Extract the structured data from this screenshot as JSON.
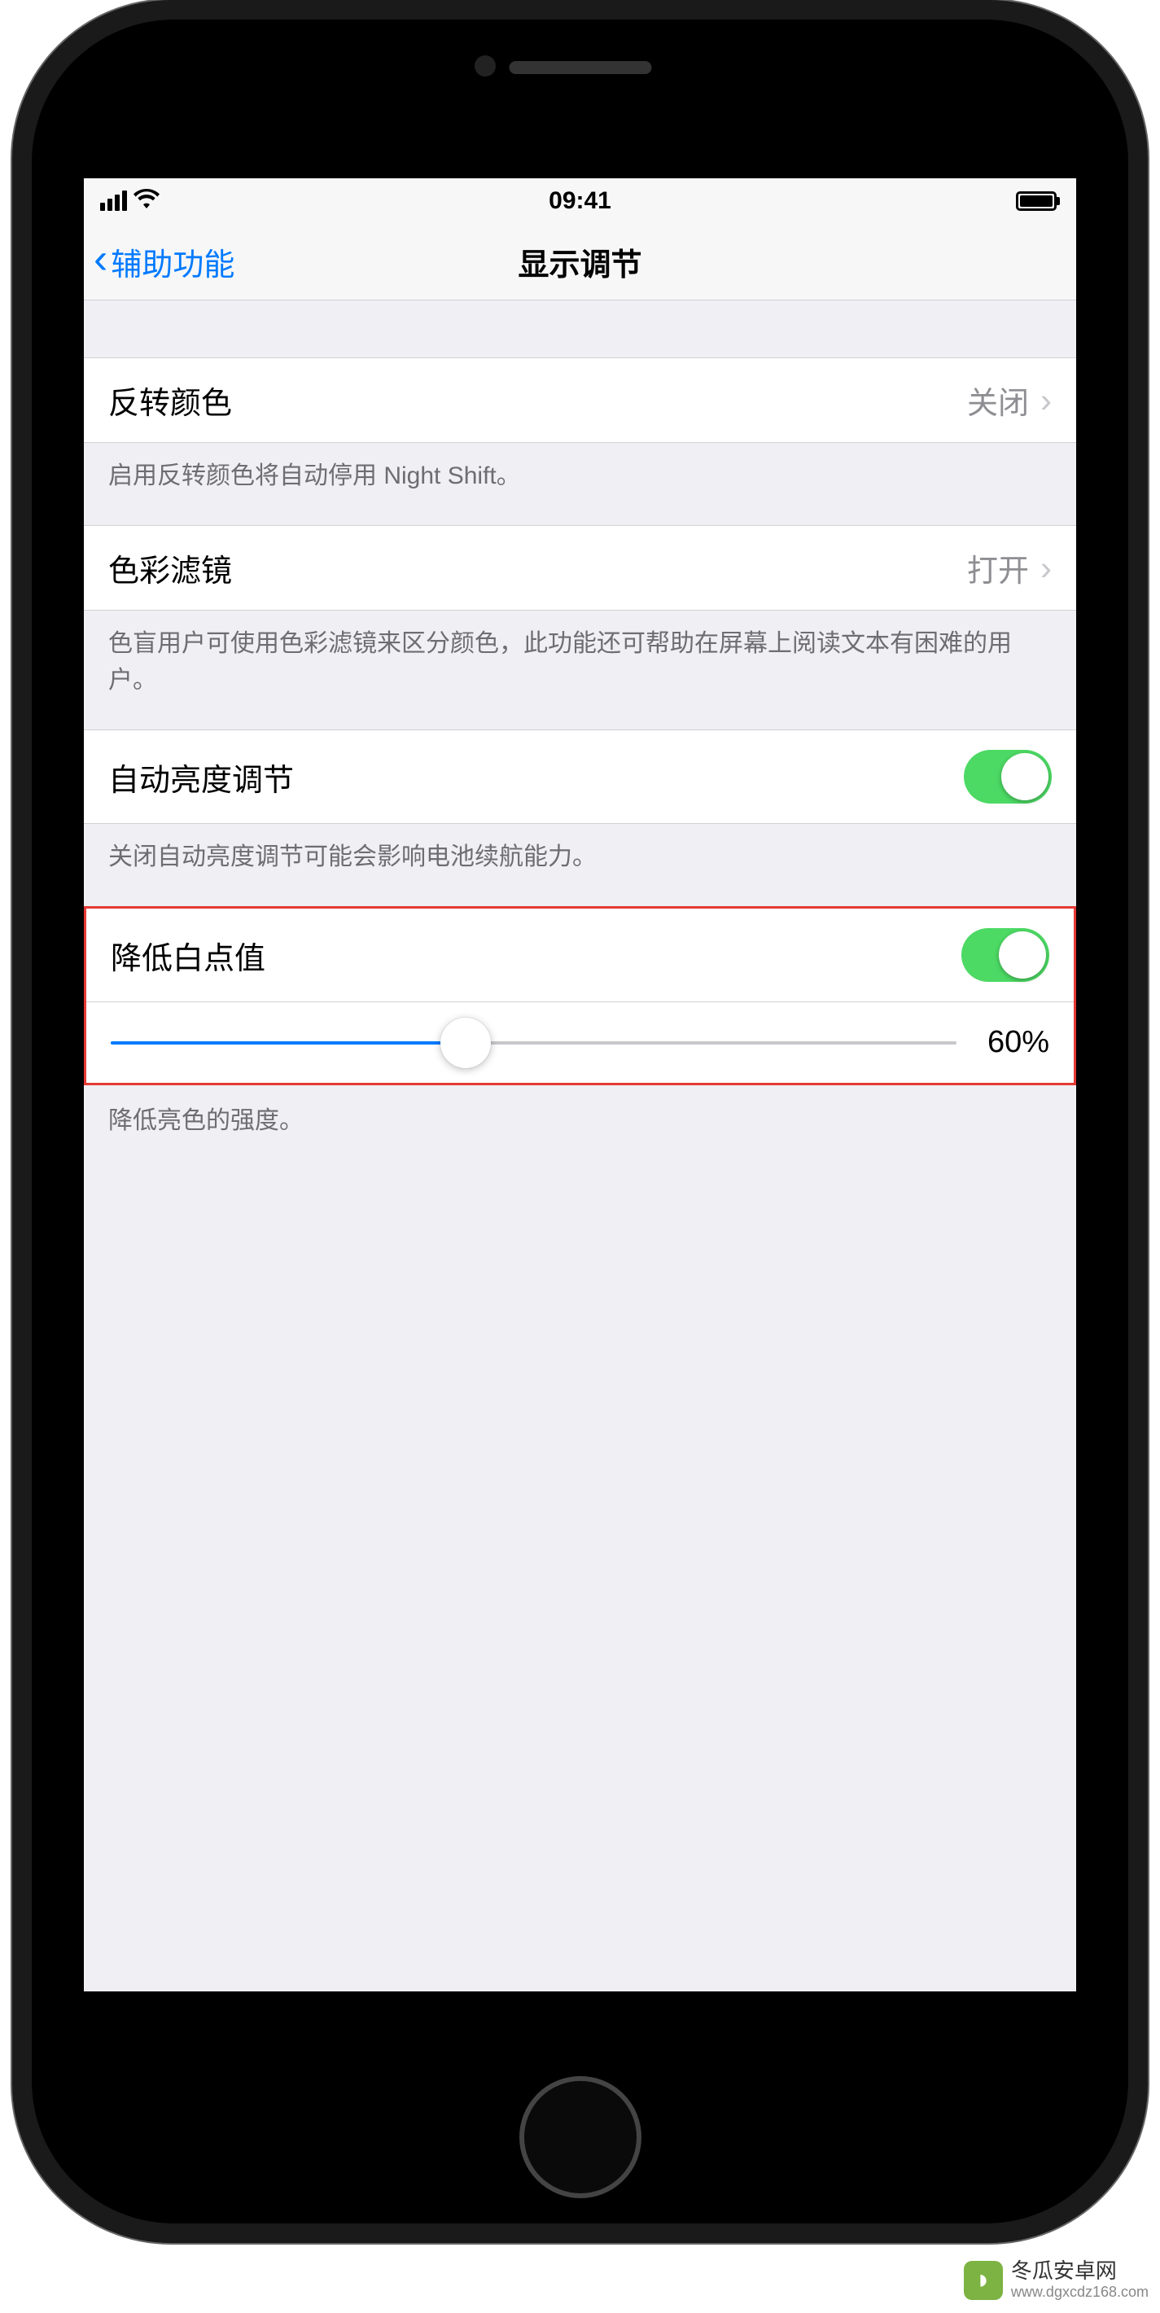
{
  "status_bar": {
    "time": "09:41"
  },
  "nav": {
    "back_label": "辅助功能",
    "title": "显示调节"
  },
  "rows": {
    "invert_colors": {
      "label": "反转颜色",
      "value": "关闭",
      "footer": "启用反转颜色将自动停用 Night Shift。"
    },
    "color_filters": {
      "label": "色彩滤镜",
      "value": "打开",
      "footer": "色盲用户可使用色彩滤镜来区分颜色，此功能还可帮助在屏幕上阅读文本有困难的用户。"
    },
    "auto_brightness": {
      "label": "自动亮度调节",
      "enabled": true,
      "footer": "关闭自动亮度调节可能会影响电池续航能力。"
    },
    "reduce_white_point": {
      "label": "降低白点值",
      "enabled": true,
      "slider_value": 60,
      "slider_display": "60%",
      "footer": "降低亮色的强度。"
    }
  },
  "watermark": {
    "name": "冬瓜安卓网",
    "url": "www.dgxcdz168.com"
  }
}
